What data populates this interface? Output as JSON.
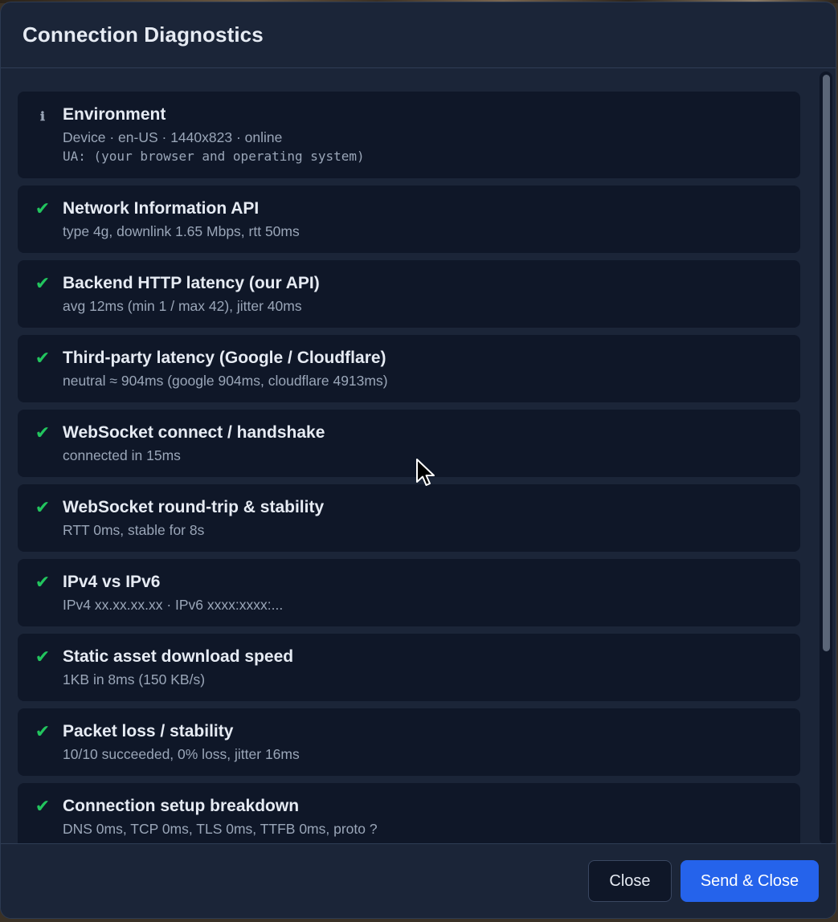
{
  "dialog": {
    "title": "Connection Diagnostics"
  },
  "checks": [
    {
      "status": "info",
      "icon": "ℹ",
      "title": "Environment",
      "detail": "Device · en-US · 1440x823 · online",
      "ua": "UA: (your browser and operating system)"
    },
    {
      "status": "pass",
      "icon": "✔",
      "title": "Network Information API",
      "detail": "type 4g, downlink 1.65 Mbps, rtt 50ms"
    },
    {
      "status": "pass",
      "icon": "✔",
      "title": "Backend HTTP latency (our API)",
      "detail": "avg 12ms (min 1 / max 42), jitter 40ms"
    },
    {
      "status": "pass",
      "icon": "✔",
      "title": "Third-party latency (Google / Cloudflare)",
      "detail": "neutral ≈ 904ms (google 904ms, cloudflare 4913ms)"
    },
    {
      "status": "pass",
      "icon": "✔",
      "title": "WebSocket connect / handshake",
      "detail": "connected in 15ms"
    },
    {
      "status": "pass",
      "icon": "✔",
      "title": "WebSocket round-trip & stability",
      "detail": "RTT 0ms, stable for 8s"
    },
    {
      "status": "pass",
      "icon": "✔",
      "title": "IPv4 vs IPv6",
      "detail": "IPv4 xx.xx.xx.xx · IPv6 xxxx:xxxx:..."
    },
    {
      "status": "pass",
      "icon": "✔",
      "title": "Static asset download speed",
      "detail": "1KB in 8ms (150 KB/s)"
    },
    {
      "status": "pass",
      "icon": "✔",
      "title": "Packet loss / stability",
      "detail": "10/10 succeeded, 0% loss, jitter 16ms"
    },
    {
      "status": "pass",
      "icon": "✔",
      "title": "Connection setup breakdown",
      "detail": "DNS 0ms, TCP 0ms, TLS 0ms, TTFB 0ms, proto ?"
    }
  ],
  "footer": {
    "close_label": "Close",
    "send_label": "Send & Close"
  },
  "colors": {
    "pass": "#22c55e",
    "info": "#9aa6b8",
    "primary": "#2563eb",
    "surface": "#1b2538",
    "card": "#0f1728"
  }
}
